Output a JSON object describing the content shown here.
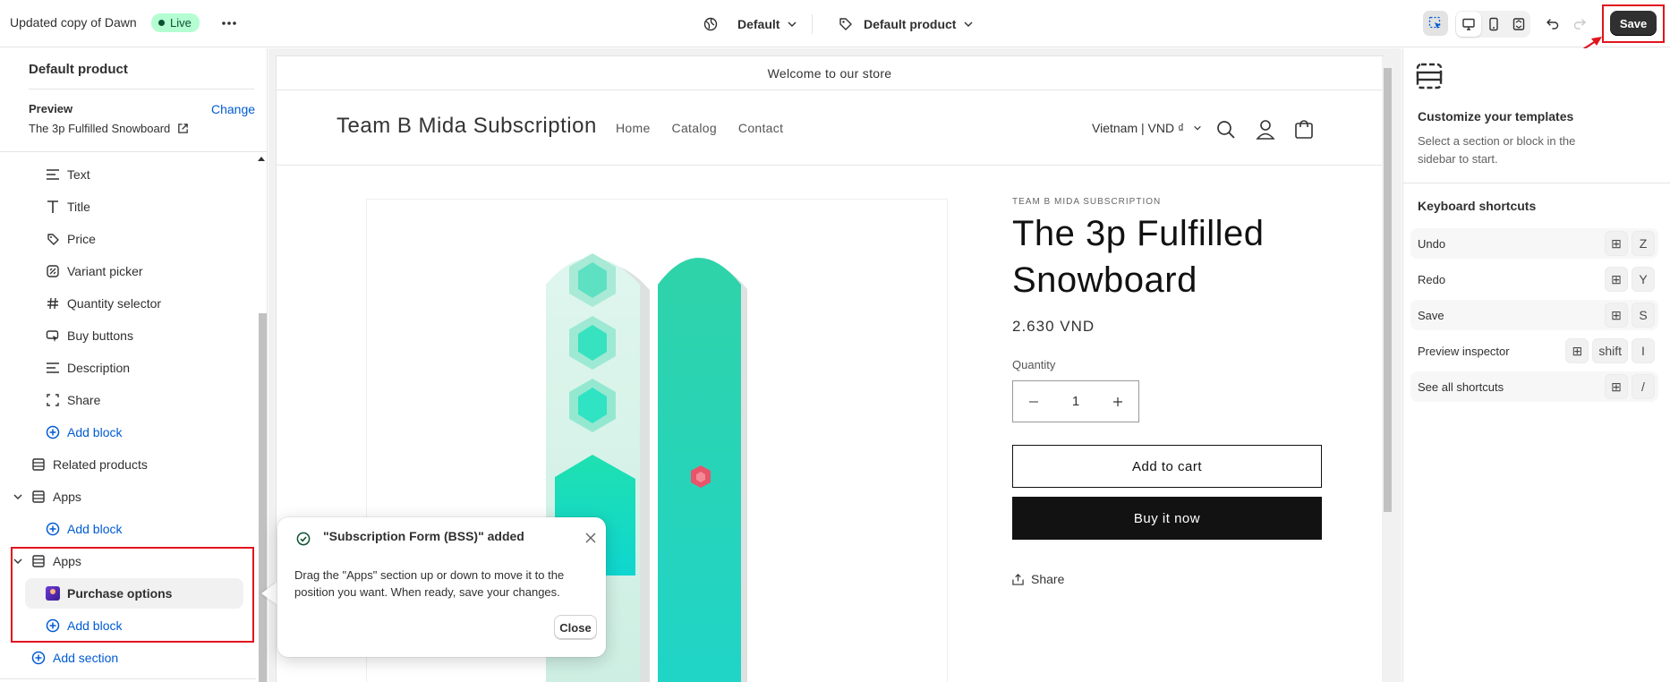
{
  "topbar": {
    "theme_name": "Updated copy of Dawn",
    "live_label": "Live",
    "more_icon": "ellipsis-icon",
    "theme_selector": {
      "label": "Default",
      "icon": "globe-icon"
    },
    "template_selector": {
      "label": "Default product",
      "icon": "tag-icon"
    },
    "tools": [
      "inspector-icon",
      "desktop-icon",
      "mobile-icon",
      "fullwidth-icon",
      "undo-icon",
      "redo-icon"
    ],
    "save_label": "Save"
  },
  "sidebar": {
    "header": "Default product",
    "preview_label": "Preview",
    "change_label": "Change",
    "preview_product": "The 3p Fulfilled Snowboard",
    "blocks": [
      {
        "label": "Text",
        "icon": "text-align-icon"
      },
      {
        "label": "Title",
        "icon": "title-icon"
      },
      {
        "label": "Price",
        "icon": "price-tag-icon"
      },
      {
        "label": "Variant picker",
        "icon": "variant-icon"
      },
      {
        "label": "Quantity selector",
        "icon": "hash-icon"
      },
      {
        "label": "Buy buttons",
        "icon": "cursor-icon"
      },
      {
        "label": "Description",
        "icon": "text-align-icon"
      },
      {
        "label": "Share",
        "icon": "share-frame-icon"
      }
    ],
    "add_block": "Add block",
    "related_products": "Related products",
    "apps_1": "Apps",
    "apps_2": "Apps",
    "purchase_options": "Purchase options",
    "add_section": "Add section"
  },
  "store": {
    "announcement": "Welcome to our store",
    "logo": "Team B Mida Subscription",
    "nav": [
      "Home",
      "Catalog",
      "Contact"
    ],
    "country": "Vietnam | VND ₫",
    "vendor": "TEAM B MIDA SUBSCRIPTION",
    "product_title": "The 3p Fulfilled Snowboard",
    "price": "2.630 VND",
    "quantity_label": "Quantity",
    "quantity_value": "1",
    "add_to_cart": "Add to cart",
    "buy_now": "Buy it now",
    "share": "Share"
  },
  "toast": {
    "title": "\"Subscription Form (BSS)\" added",
    "body": "Drag the \"Apps\" section up or down to move it to the position you want. When ready, save your changes.",
    "close_label": "Close"
  },
  "right_panel": {
    "title": "Customize your templates",
    "description": "Select a section or block in the sidebar to start.",
    "shortcuts_title": "Keyboard shortcuts",
    "shortcuts": [
      {
        "label": "Undo",
        "keys": [
          "⊞",
          "Z"
        ]
      },
      {
        "label": "Redo",
        "keys": [
          "⊞",
          "Y"
        ]
      },
      {
        "label": "Save",
        "keys": [
          "⊞",
          "S"
        ]
      },
      {
        "label": "Preview inspector",
        "keys": [
          "⊞",
          "shift",
          "I"
        ]
      },
      {
        "label": "See all shortcuts",
        "keys": [
          "⊞",
          "/"
        ]
      }
    ]
  },
  "colors": {
    "accent_blue": "#005bd3",
    "live_green": "#b4fed2",
    "highlight_red": "#e1141e",
    "snowboard_teal": "#2fd3a9"
  }
}
